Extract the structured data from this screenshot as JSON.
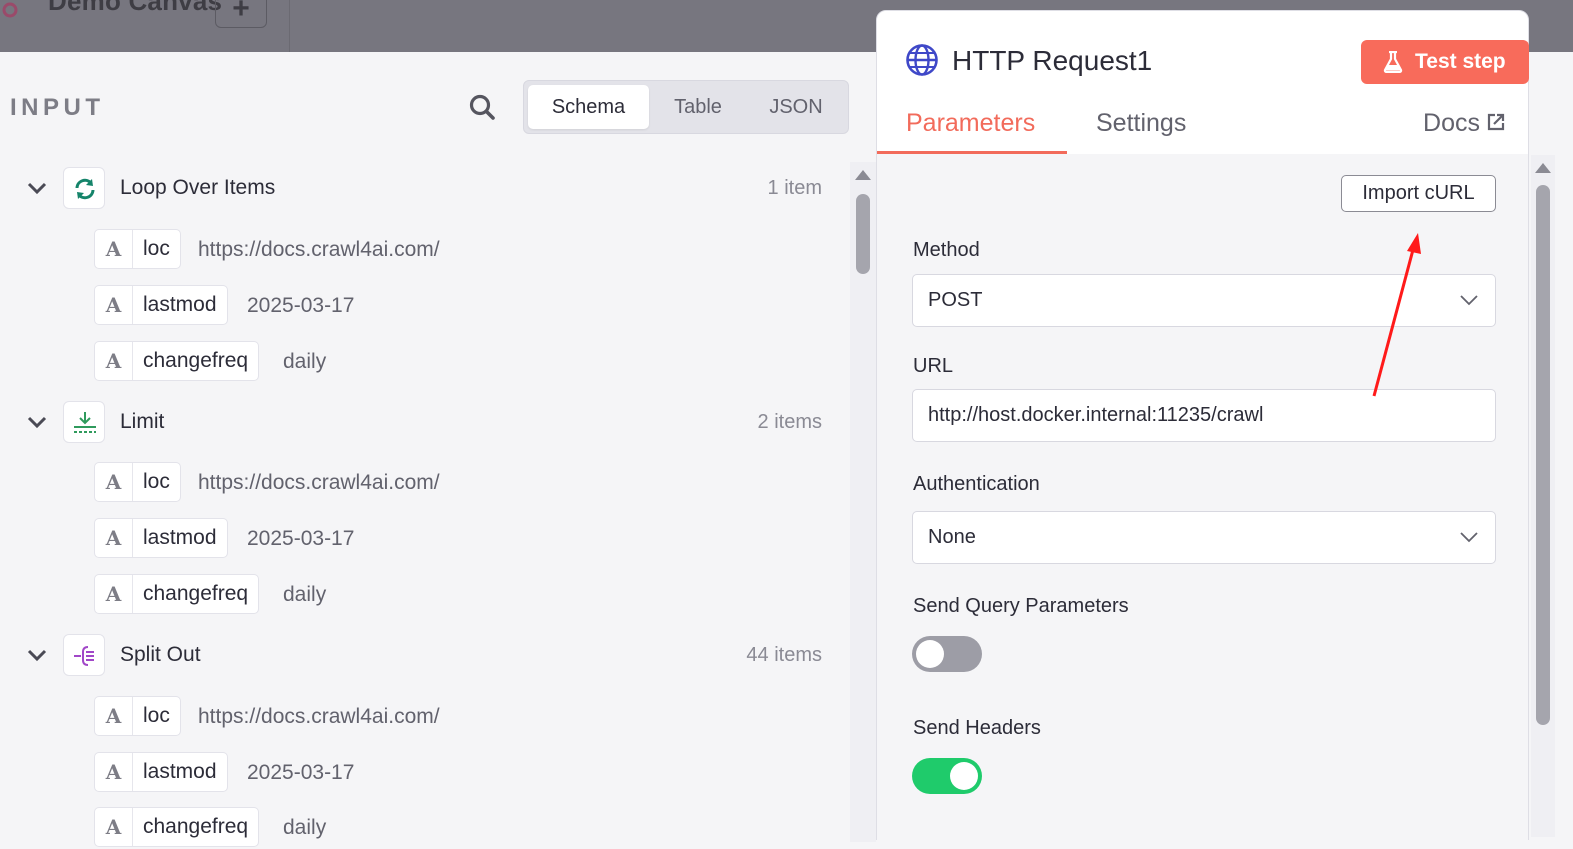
{
  "topbar": {
    "canvas_name": "Demo Canvas",
    "add_label": "+"
  },
  "input_panel": {
    "title": "INPUT",
    "view_tabs": [
      {
        "label": "Schema",
        "active": true
      },
      {
        "label": "Table",
        "active": false
      },
      {
        "label": "JSON",
        "active": false
      }
    ],
    "nodes": [
      {
        "name": "Loop Over Items",
        "count": "1 item",
        "icon": "loop-icon",
        "fields": [
          {
            "type": "A",
            "name": "loc",
            "value": "https://docs.crawl4ai.com/"
          },
          {
            "type": "A",
            "name": "lastmod",
            "value": "2025-03-17"
          },
          {
            "type": "A",
            "name": "changefreq",
            "value": "daily"
          }
        ]
      },
      {
        "name": "Limit",
        "count": "2 items",
        "icon": "limit-icon",
        "fields": [
          {
            "type": "A",
            "name": "loc",
            "value": "https://docs.crawl4ai.com/"
          },
          {
            "type": "A",
            "name": "lastmod",
            "value": "2025-03-17"
          },
          {
            "type": "A",
            "name": "changefreq",
            "value": "daily"
          }
        ]
      },
      {
        "name": "Split Out",
        "count": "44 items",
        "icon": "split-out-icon",
        "fields": [
          {
            "type": "A",
            "name": "loc",
            "value": "https://docs.crawl4ai.com/"
          },
          {
            "type": "A",
            "name": "lastmod",
            "value": "2025-03-17"
          },
          {
            "type": "A",
            "name": "changefreq",
            "value": "daily"
          }
        ]
      }
    ]
  },
  "node_panel": {
    "title": "HTTP Request1",
    "test_button": "Test step",
    "tabs": [
      {
        "label": "Parameters",
        "active": true
      },
      {
        "label": "Settings",
        "active": false
      }
    ],
    "docs_label": "Docs",
    "import_curl": "Import cURL",
    "method": {
      "label": "Method",
      "value": "POST"
    },
    "url": {
      "label": "URL",
      "value": "http://host.docker.internal:11235/crawl"
    },
    "authentication": {
      "label": "Authentication",
      "value": "None"
    },
    "send_query": {
      "label": "Send Query Parameters",
      "enabled": false
    },
    "send_headers": {
      "label": "Send Headers",
      "enabled": true
    }
  },
  "colors": {
    "accent": "#f26b5b",
    "test_button": "#f86b5b",
    "toggle_on": "#1fcb6b",
    "annotation_arrow": "#ff1a1a"
  }
}
